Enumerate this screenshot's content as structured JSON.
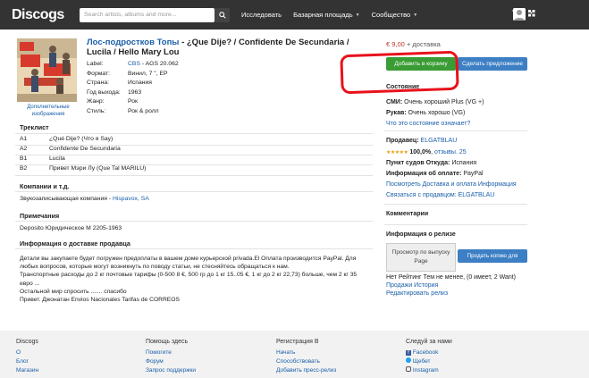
{
  "header": {
    "logo": "Discogs",
    "search_placeholder": "Search artists, albums and more...",
    "nav": [
      "Исследовать",
      "Базарная площадь",
      "Сообщество"
    ]
  },
  "release": {
    "artist": "Лос-подростков Топы",
    "title_rest": " - ¿Que Dije? / Confidente De Secundaria / Lucila / Hello Mary Lou",
    "more_images": "Дополнительные изображения",
    "meta": [
      {
        "k": "Label:",
        "v_link": "CBS",
        "v": " - AGS 20.062"
      },
      {
        "k": "Формат:",
        "v_link": "",
        "v": "Винил, 7 \", EP"
      },
      {
        "k": "Страна:",
        "v_link": "",
        "v": "Испания"
      },
      {
        "k": "Год выхода:",
        "v_link": "",
        "v": "1963"
      },
      {
        "k": "Жанр:",
        "v_link": "",
        "v": "Рок"
      },
      {
        "k": "Стиль:",
        "v_link": "",
        "v": "Рок & ролл"
      }
    ]
  },
  "tracklist": {
    "heading": "Треклист",
    "tracks": [
      {
        "pos": "A1",
        "title": "¿Qué Dije? (Что я Say)"
      },
      {
        "pos": "A2",
        "title": "Confidente De Secundaria"
      },
      {
        "pos": "B1",
        "title": "Lucila"
      },
      {
        "pos": "B2",
        "title": "Привет Мэри Лу (Que Tal MARILU)"
      }
    ]
  },
  "companies": {
    "heading": "Компании и т.д.",
    "line_prefix": "Звукозаписывающая компания - ",
    "line_link": "Hispavox, SA"
  },
  "notes": {
    "heading": "Примечания",
    "text": "Deposito Юридическое М 2205-1963"
  },
  "shipping": {
    "heading": "Информация о доставке продавца",
    "lines": [
      "Детали вы закупаете будет погружен предоплаты в вашем доме курьерской privada.El Оплата производится PayPal. Для",
      "любых вопросов, которые могут возникнуть по поводу статьи, не стесняйтесь обращаться к нам.",
      "Транспортные расходы до 2 кг почтовые тарифы (0-500 8 €, 500 гр до 1 кг 15..05 €, 1 кг до 2 кг 22,73) больше, чем 2 кг 35",
      "евро ...",
      "Остальной мир спросить ....... спасибо",
      "Привет. Джонатан Envios Nacionales Tarifas de CORREOS"
    ]
  },
  "buy": {
    "price": "€ 9,00",
    "shipping": " + доставка",
    "add_to_cart": "Добавить в корзину",
    "make_offer": "Сделать предложение"
  },
  "condition": {
    "heading": "Состояние",
    "media_label": "СМИ:",
    "media_value": "Очень хороший Plus (VG +)",
    "sleeve_label": "Рукав:",
    "sleeve_value": "Очень хорошо (VG)",
    "meaning_link": "Что это состояние означает?"
  },
  "seller": {
    "label": "Продавец:",
    "name": "ELGATBLAU",
    "rating": "100,0%",
    "reviews": "отзывы. 25",
    "ships_label": "Пункт судов Откуда:",
    "ships_value": "Испания",
    "payment_label": "Информация об оплате:",
    "payment_value": "PayPal",
    "terms_link": "Посмотреть Доставка и оплата Информация",
    "contact_link": "Связаться с продавцом: ELGATBLAU"
  },
  "comments": {
    "heading": "Комментарии"
  },
  "release_info": {
    "heading": "Информация о релизе",
    "view_release": "Просмотр по выпуску Page",
    "sell_copy": "Продать копию для продажи",
    "rating_text": "Нет Рейтинг Тем не менее, (0 имеет, 2 Want)",
    "sales_history": "Продажи История",
    "edit_release": "Редактировать релиз"
  },
  "footer": {
    "cols": [
      {
        "heading": "Discogs",
        "links": [
          "О",
          "Блог",
          "Магазин"
        ]
      },
      {
        "heading": "Помощь здесь",
        "links": [
          "Помогите",
          "Форум",
          "Запрос поддержки"
        ]
      },
      {
        "heading": "Регистрация В",
        "links": [
          "Начать",
          "Способствовать",
          "Добавить пресс-релиз"
        ]
      },
      {
        "heading": "Следуй за нами",
        "links": [
          "Facebook",
          "Щебет",
          "Instagram"
        ]
      }
    ]
  },
  "colors": {
    "accent": "#1a5fa8",
    "cart_button": "#3a9c34",
    "offer_button": "#3d7fc4",
    "price": "#c0392b",
    "annotation": "#e8121c"
  }
}
